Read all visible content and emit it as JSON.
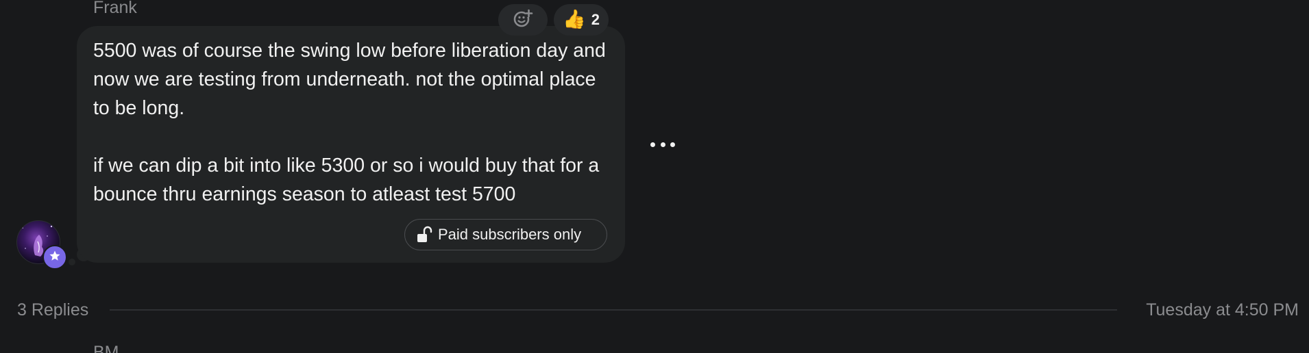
{
  "message": {
    "author": "Frank",
    "text": "5500 was of course the swing low before liberation day and now we are testing from underneath. not the optimal place to be long.\n\nif we can dip a bit into like 5300 or so i would buy that for a bounce thru earnings season to atleast test 5700",
    "paid_label": "Paid subscribers only",
    "reactions": [
      {
        "icon": "add-reaction-icon"
      },
      {
        "icon": "thumbs-up-icon",
        "emoji": "👍",
        "count": "2"
      }
    ],
    "more_icon": "more-dots-icon",
    "avatar_badge_icon": "star-icon"
  },
  "thread": {
    "replies_label": "3 Replies",
    "timestamp": "Tuesday at 4:50 PM"
  },
  "next_message": {
    "author": "BM"
  },
  "colors": {
    "background": "#18191b",
    "bubble": "#222425",
    "badge": "#7867e6",
    "muted_text": "#8b8c8f"
  }
}
